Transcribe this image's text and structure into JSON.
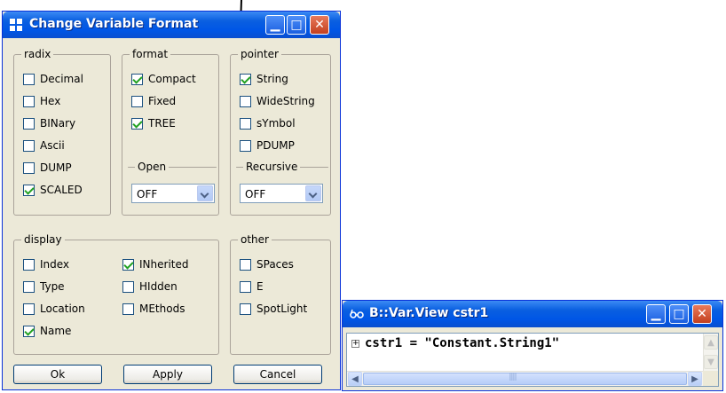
{
  "dialog": {
    "title": "Change Variable Format",
    "groups": {
      "radix": {
        "label": "radix",
        "items": [
          {
            "label": "Decimal",
            "checked": false
          },
          {
            "label": "Hex",
            "checked": false
          },
          {
            "label": "BINary",
            "checked": false
          },
          {
            "label": "Ascii",
            "checked": false
          },
          {
            "label": "DUMP",
            "checked": false
          },
          {
            "label": "SCALED",
            "checked": true
          }
        ]
      },
      "format": {
        "label": "format",
        "items": [
          {
            "label": "Compact",
            "checked": true
          },
          {
            "label": "Fixed",
            "checked": false
          },
          {
            "label": "TREE",
            "checked": true
          }
        ],
        "open_label": "Open",
        "open_value": "OFF"
      },
      "pointer": {
        "label": "pointer",
        "items": [
          {
            "label": "String",
            "checked": true
          },
          {
            "label": "WideString",
            "checked": false
          },
          {
            "label": "sYmbol",
            "checked": false
          },
          {
            "label": "PDUMP",
            "checked": false
          }
        ],
        "recursive_label": "Recursive",
        "recursive_value": "OFF"
      },
      "display": {
        "label": "display",
        "col1": [
          {
            "label": "Index",
            "checked": false
          },
          {
            "label": "Type",
            "checked": false
          },
          {
            "label": "Location",
            "checked": false
          },
          {
            "label": "Name",
            "checked": true
          }
        ],
        "col2": [
          {
            "label": "INherited",
            "checked": true
          },
          {
            "label": "HIdden",
            "checked": false
          },
          {
            "label": "MEthods",
            "checked": false
          }
        ]
      },
      "other": {
        "label": "other",
        "items": [
          {
            "label": "SPaces",
            "checked": false
          },
          {
            "label": "E",
            "checked": false
          },
          {
            "label": "SpotLight",
            "checked": false
          }
        ]
      }
    },
    "buttons": {
      "ok": "Ok",
      "apply": "Apply",
      "cancel": "Cancel"
    }
  },
  "view_window": {
    "title": "B::Var.View cstr1",
    "content": "cstr1 = \"Constant.String1\""
  },
  "colors": {
    "titlebar": "#0a5fe0",
    "dialog_bg": "#ece9d8",
    "check": "#21a121"
  }
}
